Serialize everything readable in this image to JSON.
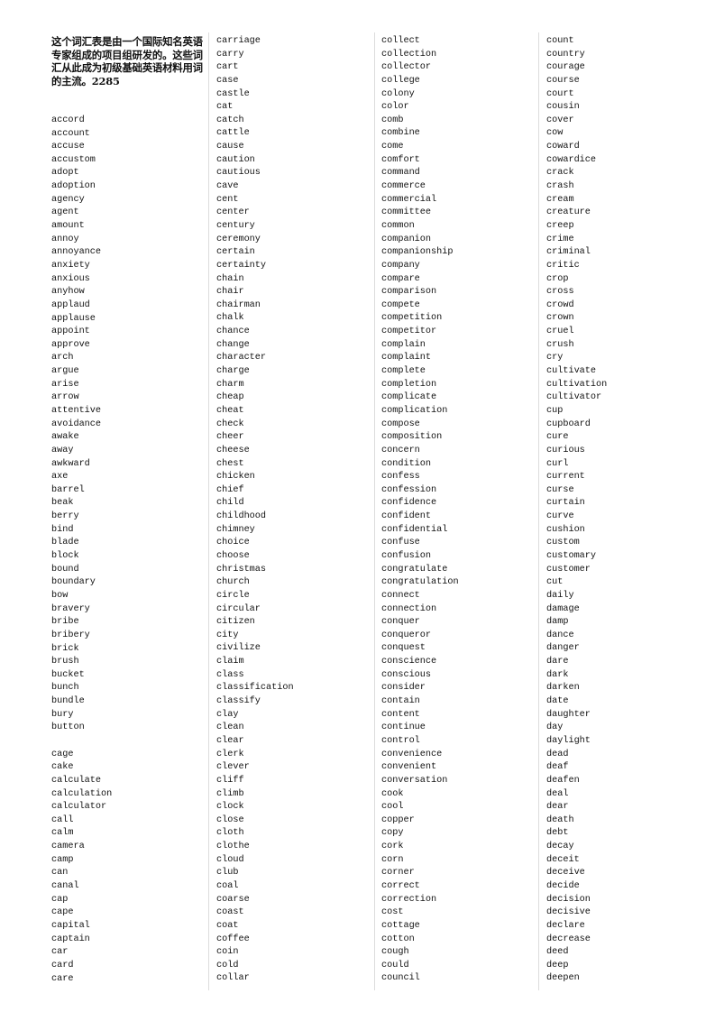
{
  "intro": "这个词汇表是由一个国际知名英语专家组成的项目组研发的。这些词汇从此成为初级基础英语材料用词的主流。2285",
  "columns": [
    [
      "accord",
      "account",
      "accuse",
      "accustom",
      "adopt",
      "adoption",
      "agency",
      "agent",
      "amount",
      "annoy",
      "annoyance",
      "anxiety",
      "anxious",
      "anyhow",
      "applaud",
      "applause",
      "appoint",
      "approve",
      "arch",
      "argue",
      "arise",
      "arrow",
      "attentive",
      "avoidance",
      "awake",
      "away",
      "awkward",
      "axe",
      "barrel",
      "beak",
      "berry",
      "bind",
      "blade",
      "block",
      "bound",
      "boundary",
      "bow",
      "bravery",
      "bribe",
      "bribery",
      "brick",
      "brush",
      "bucket",
      "bunch",
      "bundle",
      "bury",
      "button",
      "",
      "cage",
      "cake",
      "calculate",
      "calculation",
      "calculator",
      "call",
      "calm",
      "camera",
      "camp",
      "can",
      "canal",
      "cap",
      "cape",
      "capital",
      "captain",
      "car",
      "card",
      "care"
    ],
    [
      "carriage",
      "carry",
      "cart",
      "case",
      "castle",
      "cat",
      "catch",
      "cattle",
      "cause",
      "caution",
      "cautious",
      "cave",
      "cent",
      "center",
      "century",
      "ceremony",
      "certain",
      "certainty",
      "chain",
      "chair",
      "chairman",
      "chalk",
      "chance",
      "change",
      "character",
      "charge",
      "charm",
      "cheap",
      "cheat",
      "check",
      "cheer",
      "cheese",
      "chest",
      "chicken",
      "chief",
      "child",
      "childhood",
      "chimney",
      "choice",
      "choose",
      "christmas",
      "church",
      "circle",
      "circular",
      "citizen",
      "city",
      "civilize",
      "claim",
      "class",
      "classification",
      "classify",
      "clay",
      "clean",
      "clear",
      "clerk",
      "clever",
      "cliff",
      "climb",
      "clock",
      "close",
      "cloth",
      "clothe",
      "cloud",
      "club",
      "coal",
      "coarse",
      "coast",
      "coat",
      "coffee",
      "coin",
      "cold",
      "collar"
    ],
    [
      "collect",
      "collection",
      "collector",
      "college",
      "colony",
      "color",
      "comb",
      "combine",
      "come",
      "comfort",
      "command",
      "commerce",
      "commercial",
      "committee",
      "common",
      "companion",
      "companionship",
      "company",
      "compare",
      "comparison",
      "compete",
      "competition",
      "competitor",
      "complain",
      "complaint",
      "complete",
      "completion",
      "complicate",
      "complication",
      "compose",
      "composition",
      "concern",
      "condition",
      "confess",
      "confession",
      "confidence",
      "confident",
      "confidential",
      "confuse",
      "confusion",
      "congratulate",
      "congratulation",
      "connect",
      "connection",
      "conquer",
      "conqueror",
      "conquest",
      "conscience",
      "conscious",
      "consider",
      "contain",
      "content",
      "continue",
      "control",
      "convenience",
      "convenient",
      "conversation",
      "cook",
      "cool",
      "copper",
      "copy",
      "cork",
      "corn",
      "corner",
      "correct",
      "correction",
      "cost",
      "cottage",
      "cotton",
      "cough",
      "could",
      "council"
    ],
    [
      "count",
      "country",
      "courage",
      "course",
      "court",
      "cousin",
      "cover",
      "cow",
      "coward",
      "cowardice",
      "crack",
      "crash",
      "cream",
      "creature",
      "creep",
      "crime",
      "criminal",
      "critic",
      "crop",
      "cross",
      "crowd",
      "crown",
      "cruel",
      "crush",
      "cry",
      "cultivate",
      "cultivation",
      "cultivator",
      "cup",
      "cupboard",
      "cure",
      "curious",
      "curl",
      "current",
      "curse",
      "curtain",
      "curve",
      "cushion",
      "custom",
      "customary",
      "customer",
      "cut",
      "daily",
      "damage",
      "damp",
      "dance",
      "danger",
      "dare",
      "dark",
      "darken",
      "date",
      "daughter",
      "day",
      "daylight",
      "dead",
      "deaf",
      "deafen",
      "deal",
      "dear",
      "death",
      "debt",
      "decay",
      "deceit",
      "deceive",
      "decide",
      "decision",
      "decisive",
      "declare",
      "decrease",
      "deed",
      "deep",
      "deepen"
    ]
  ]
}
